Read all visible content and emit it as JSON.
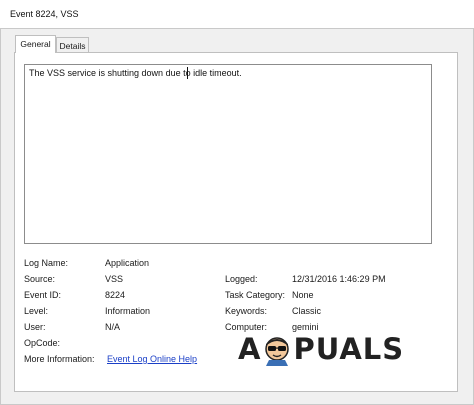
{
  "window": {
    "title": "Event 8224, VSS"
  },
  "tabs": [
    {
      "label": "General",
      "active": true
    },
    {
      "label": "Details",
      "active": false
    }
  ],
  "description": "The VSS service is shutting down due to idle timeout.",
  "fields": {
    "log_name": {
      "label": "Log Name:",
      "value": "Application"
    },
    "source": {
      "label": "Source:",
      "value": "VSS"
    },
    "logged": {
      "label": "Logged:",
      "value": "12/31/2016 1:46:29 PM"
    },
    "event_id": {
      "label": "Event ID:",
      "value": "8224"
    },
    "task_category": {
      "label": "Task Category:",
      "value": "None"
    },
    "level": {
      "label": "Level:",
      "value": "Information"
    },
    "keywords": {
      "label": "Keywords:",
      "value": "Classic"
    },
    "user": {
      "label": "User:",
      "value": "N/A"
    },
    "computer": {
      "label": "Computer:",
      "value": "gemini"
    },
    "opcode": {
      "label": "OpCode:",
      "value": ""
    },
    "more_info": {
      "label": "More Information:",
      "link": "Event Log Online Help"
    }
  },
  "watermark": {
    "text_left": "A",
    "text_right": "PUALS"
  },
  "colors": {
    "link": "#1a3fc7",
    "panel_bg": "#f0f0f0"
  }
}
